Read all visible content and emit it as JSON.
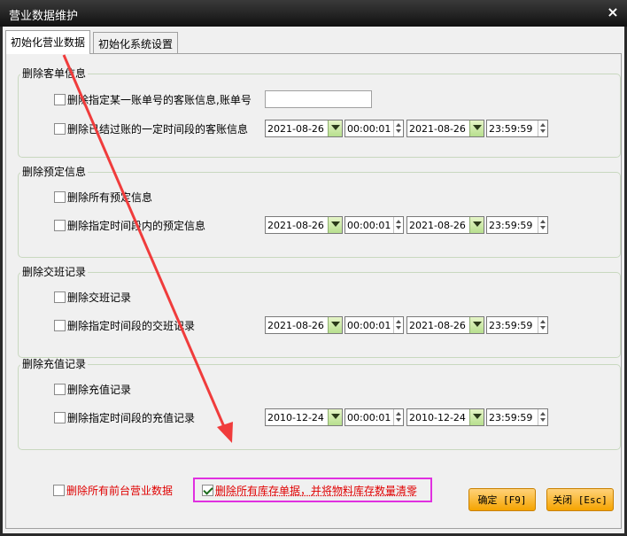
{
  "window": {
    "title": "营业数据维护",
    "close_glyph": "×"
  },
  "tabs": [
    {
      "label": "初始化营业数据",
      "active": true
    },
    {
      "label": "初始化系统设置",
      "active": false
    }
  ],
  "groups": {
    "bill": {
      "legend": "删除客单信息",
      "specific_label": "删除指定某一账单号的客账信息,账单号",
      "bill_no_value": "",
      "period_label": "删除已结过账的一定时间段的客账信息",
      "start_date": "2021-08-26",
      "start_time": "00:00:01",
      "end_date": "2021-08-26",
      "end_time": "23:59:59"
    },
    "booking": {
      "legend": "删除预定信息",
      "all_label": "删除所有预定信息",
      "period_label": "删除指定时间段内的预定信息",
      "start_date": "2021-08-26",
      "start_time": "00:00:01",
      "end_date": "2021-08-26",
      "end_time": "23:59:59"
    },
    "shift": {
      "legend": "删除交班记录",
      "all_label": "删除交班记录",
      "period_label": "删除指定时间段的交班记录",
      "start_date": "2021-08-26",
      "start_time": "00:00:01",
      "end_date": "2021-08-26",
      "end_time": "23:59:59"
    },
    "recharge": {
      "legend": "删除充值记录",
      "all_label": "删除充值记录",
      "period_label": "删除指定时间段的充值记录",
      "start_date": "2010-12-24",
      "start_time": "00:00:01",
      "end_date": "2010-12-24",
      "end_time": "23:59:59"
    }
  },
  "bottom": {
    "delete_all_label": "删除所有前台营业数据",
    "delete_all_checked": false,
    "clear_stock_label": "删除所有库存单据，并将物料库存数量清零",
    "clear_stock_checked": true,
    "confirm_label": "确定 [F9]",
    "close_label": "关闭 [Esc]"
  },
  "colors": {
    "annotation_arrow": "#f03c3c",
    "highlight_box": "#e030e0",
    "button": "#f5a400",
    "dropdown": "#b7df8e"
  }
}
